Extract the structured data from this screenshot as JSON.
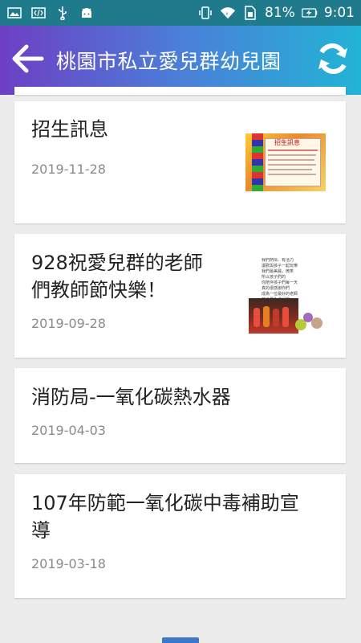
{
  "status": {
    "battery": "81%",
    "time": "9:01"
  },
  "header": {
    "title": "桃園市私立愛兒群幼兒園"
  },
  "items": [
    {
      "title": "招生訊息",
      "date": "2019-11-28"
    },
    {
      "title_line1": "928祝愛兒群的老師",
      "title_line2": "們教師節快樂！",
      "date": "2019-09-28"
    },
    {
      "title": "消防局-一氧化碳熱水器",
      "date": "2019-04-03"
    },
    {
      "title_line1": "107年防範一氧化碳中毒補助宣",
      "title_line2": "導",
      "date": "2019-03-18"
    }
  ],
  "thumbs": {
    "thumb1_heading": "招生訊息",
    "thumb2_lines": [
      "我們熱情．有活力",
      "讓歡與孩子一起玩樂",
      "我們最美麗，微笑",
      "所以孩子們的",
      "你陪伴孩子們每一天",
      "真的很感謝你們",
      "成為一位最好的老師",
      "孩子們永遠記得"
    ]
  },
  "colors": {
    "status_bar": "#1f7b8c",
    "gradient_start": "#6e3fc4",
    "gradient_end": "#21b4d6"
  }
}
